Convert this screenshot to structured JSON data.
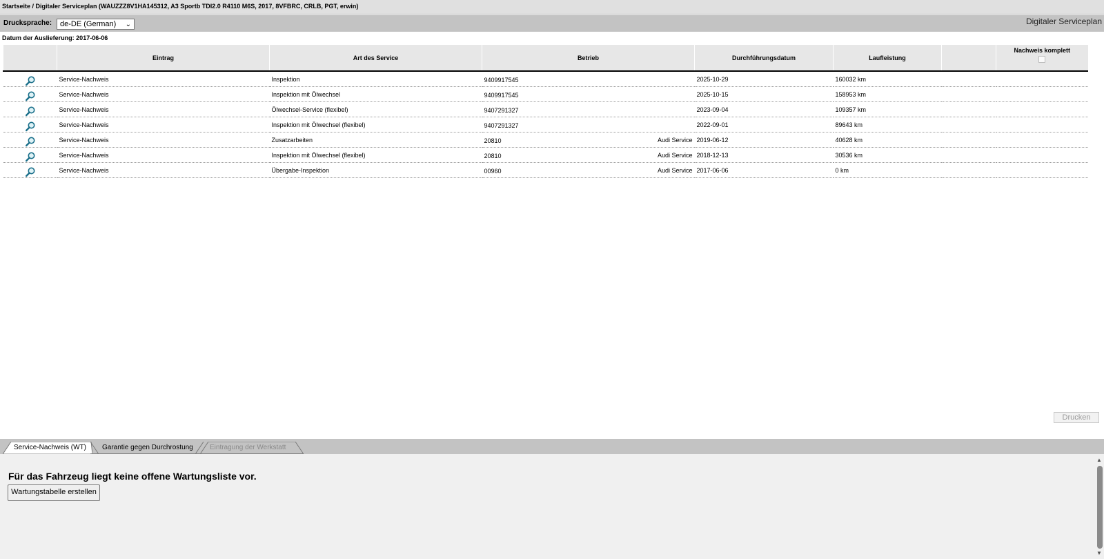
{
  "breadcrumb": "Startseite / Digitaler Serviceplan (WAUZZZ8V1HA145312, A3 Sportb TDI2.0 R4110 M6S, 2017, 8VFBRC, CRLB, PGT, erwin)",
  "language_bar": {
    "label": "Drucksprache:",
    "selected": "de-DE (German)",
    "app_title": "Digitaler Serviceplan"
  },
  "delivery_date": "Datum der Auslieferung: 2017-06-06",
  "table": {
    "headers": {
      "icon": "",
      "entry": "Eintrag",
      "service_type": "Art des Service",
      "workshop": "Betrieb",
      "date": "Durchführungsdatum",
      "mileage": "Laufleistung",
      "extra": "",
      "complete": "Nachweis komplett"
    },
    "rows": [
      {
        "entry": "Service-Nachweis",
        "service_type": "Inspektion",
        "workshop_no": "9409917545",
        "workshop_name": "",
        "date": "2025-10-29",
        "mileage": "160032 km"
      },
      {
        "entry": "Service-Nachweis",
        "service_type": "Inspektion mit Ölwechsel",
        "workshop_no": "9409917545",
        "workshop_name": "",
        "date": "2025-10-15",
        "mileage": "158953 km"
      },
      {
        "entry": "Service-Nachweis",
        "service_type": "Ölwechsel-Service (flexibel)",
        "workshop_no": "9407291327",
        "workshop_name": "",
        "date": "2023-09-04",
        "mileage": "109357 km"
      },
      {
        "entry": "Service-Nachweis",
        "service_type": "Inspektion mit Ölwechsel (flexibel)",
        "workshop_no": "9407291327",
        "workshop_name": "",
        "date": "2022-09-01",
        "mileage": "89643 km"
      },
      {
        "entry": "Service-Nachweis",
        "service_type": "Zusatzarbeiten",
        "workshop_no": "20810",
        "workshop_name": "Audi Service",
        "date": "2019-06-12",
        "mileage": "40628 km"
      },
      {
        "entry": "Service-Nachweis",
        "service_type": "Inspektion mit Ölwechsel (flexibel)",
        "workshop_no": "20810",
        "workshop_name": "Audi Service",
        "date": "2018-12-13",
        "mileage": "30536 km"
      },
      {
        "entry": "Service-Nachweis",
        "service_type": "Übergabe-Inspektion",
        "workshop_no": "00960",
        "workshop_name": "Audi Service",
        "date": "2017-06-06",
        "mileage": "0 km"
      }
    ]
  },
  "print_button": "Drucken",
  "tabs": [
    {
      "label": "Service-Nachweis (WT)",
      "state": "active"
    },
    {
      "label": "Garantie gegen Durchrostung",
      "state": "normal"
    },
    {
      "label": "Eintragung der Werkstatt",
      "state": "disabled"
    }
  ],
  "bottom": {
    "message": "Für das Fahrzeug liegt keine offene Wartungsliste vor.",
    "create_button": "Wartungstabelle erstellen"
  },
  "icons": {
    "row_action": "magnifier-icon",
    "scroll_up": "arrow-up-icon",
    "scroll_down": "arrow-down-icon",
    "dropdown": "chevron-down-icon"
  },
  "colors": {
    "header_bar": "#e0e0e0",
    "toolbar": "#c3c3c3",
    "table_header": "#e7e7e7",
    "icon": "#1a6f8a",
    "panel": "#f0f0f0"
  }
}
